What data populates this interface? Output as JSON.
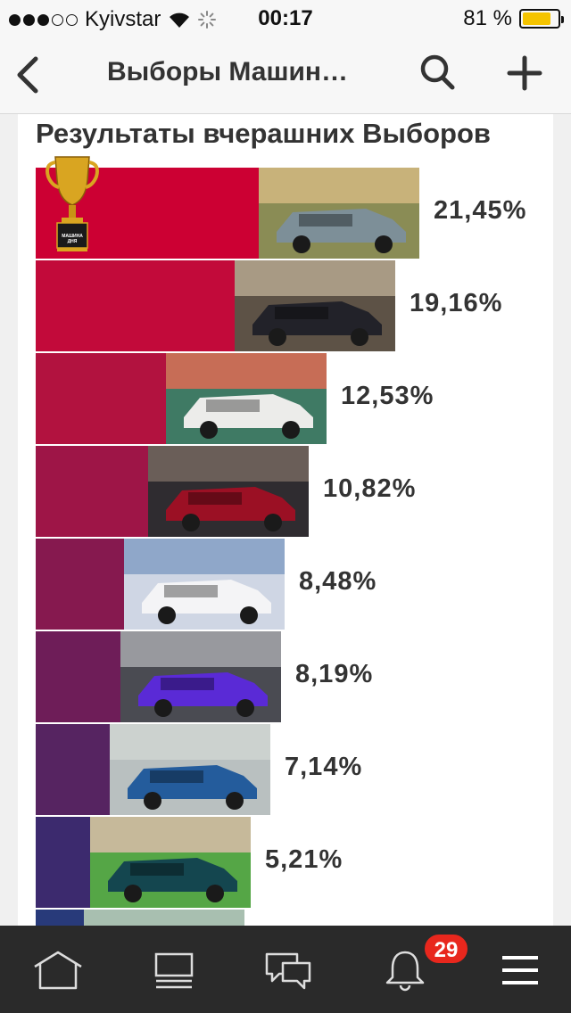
{
  "status": {
    "carrier": "Kyivstar",
    "time": "00:17",
    "battery_text": "81 %",
    "battery_level": 0.81,
    "signal_bars": 3,
    "signal_total": 5
  },
  "nav": {
    "title": "Выборы Машин…"
  },
  "results": {
    "heading": "Результаты вчерашних Выборов",
    "trophy_text": "МАШИНА ДНЯ",
    "items": [
      {
        "percent": "21,45%",
        "value": 21.45,
        "color": "#cc0033",
        "img": "gray-sedan"
      },
      {
        "percent": "19,16%",
        "value": 19.16,
        "color": "#c20a3a",
        "img": "dark-sportscar"
      },
      {
        "percent": "12,53%",
        "value": 12.53,
        "color": "#b2123f",
        "img": "white-sedan"
      },
      {
        "percent": "10,82%",
        "value": 10.82,
        "color": "#9e1547",
        "img": "red-tuned-car"
      },
      {
        "percent": "8,48%",
        "value": 8.48,
        "color": "#86194f",
        "img": "white-sport-sedan"
      },
      {
        "percent": "8,19%",
        "value": 8.19,
        "color": "#6e1d58",
        "img": "purple-sedan"
      },
      {
        "percent": "7,14%",
        "value": 7.14,
        "color": "#562461",
        "img": "blue-wagon"
      },
      {
        "percent": "5,21%",
        "value": 5.21,
        "color": "#3c2a6e",
        "img": "teal-coupe"
      },
      {
        "percent": "",
        "value": 4.6,
        "color": "#283a7a",
        "img": "partial"
      }
    ]
  },
  "tabbar": {
    "notifications_count": "29",
    "items": [
      "home-icon",
      "feed-icon",
      "messages-icon",
      "bell-icon",
      "menu-icon"
    ]
  }
}
